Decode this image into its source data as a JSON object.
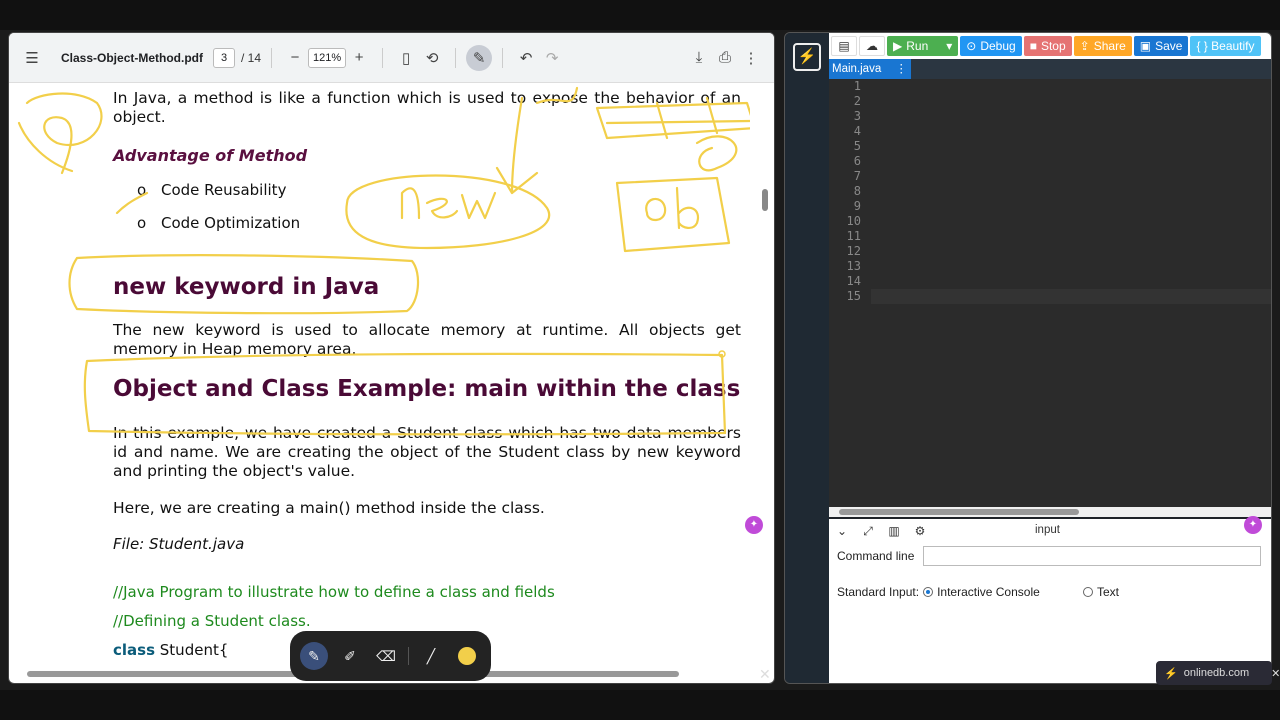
{
  "pdf_viewer": {
    "file_name": "Class-Object-Method.pdf",
    "page_current": "3",
    "page_total": "/ 14",
    "zoom": "121%"
  },
  "pdf_content": {
    "intro": "In Java, a method is like a function which is used to expose the behavior of an object.",
    "advantage_heading": "Advantage of Method",
    "bullet_marker": "o",
    "bullets": [
      "Code Reusability",
      "Code Optimization"
    ],
    "new_heading": "new keyword in Java",
    "new_text": "The new keyword is used to allocate memory at runtime. All objects get memory in Heap memory area.",
    "example_heading": "Object and Class Example: main within the class",
    "example_text": "In this example, we have created a Student class which has two data members id and name. We are creating the object of the Student class by new keyword and printing the object's value.",
    "main_text": "Here, we are creating a main() method inside the class.",
    "file_line": "File: Student.java",
    "comment1": "//Java Program to illustrate how to define a class and fields",
    "comment2": "//Defining a Student class.",
    "code_kw": "class",
    "code_rest": " Student{"
  },
  "ide": {
    "toolbar": {
      "run": "Run",
      "debug": "Debug",
      "stop": "Stop",
      "share": "Share",
      "save": "Save",
      "beautify": "{ } Beautify"
    },
    "tab_name": "Main.java",
    "line_numbers": [
      "1",
      "2",
      "3",
      "4",
      "5",
      "6",
      "7",
      "8",
      "9",
      "10",
      "11",
      "12",
      "13",
      "14",
      "15"
    ],
    "io": {
      "title": "input",
      "cmd_label": "Command line",
      "std_label": "Standard Input:",
      "interactive": "Interactive Console",
      "text": "Text"
    }
  },
  "badge": "onlinedb.com",
  "colors": {
    "run": "#4caf50",
    "debug": "#2196f3",
    "stop": "#e57373",
    "share": "#ffa726",
    "save": "#1976d2",
    "beautify": "#4fc3f7",
    "annotation": "#f2cf4a"
  }
}
